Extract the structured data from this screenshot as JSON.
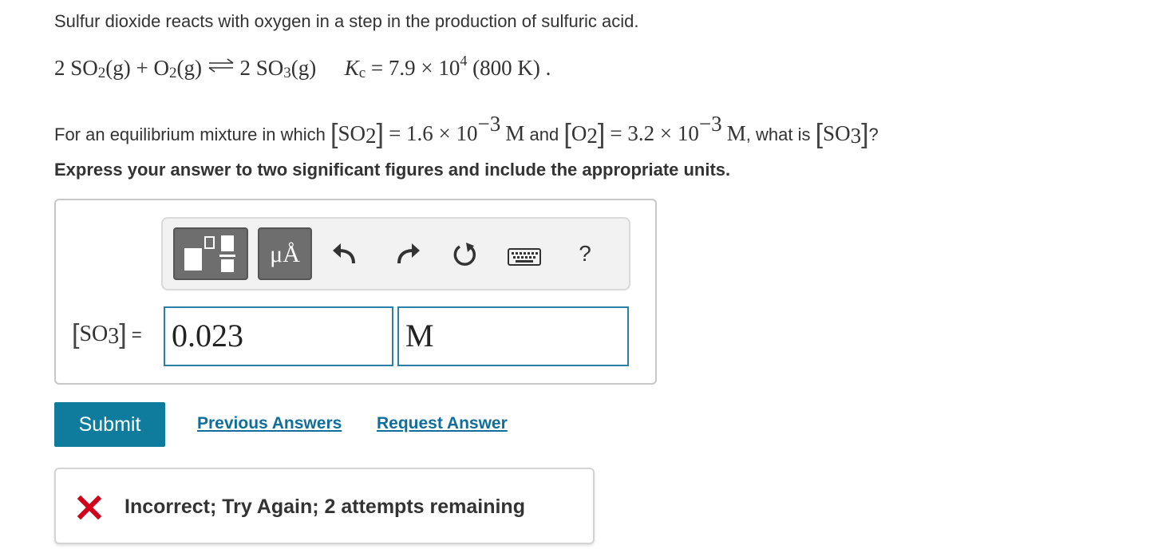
{
  "intro": "Sulfur dioxide reacts with oxygen in a step in the production of sulfuric acid.",
  "equation": {
    "coef1": "2",
    "so2": "SO",
    "so2_sub": "2",
    "phase1": "(g)",
    "plus": "+",
    "o2": "O",
    "o2_sub": "2",
    "phase2": "(g)",
    "coef2": "2",
    "so3": "SO",
    "so3_sub": "3",
    "phase3": "(g)",
    "k": "K",
    "k_sub": "c",
    "k_eq": "= 7.9 × 10",
    "k_exp": "4",
    "temp": "(800 K) ."
  },
  "question": {
    "prefix": "For an equilibrium mixture in which",
    "so2": "SO",
    "so2_sub": "2",
    "so2_val": "= 1.6 × 10",
    "so2_exp": "−3",
    "so2_unit": "M",
    "and": "and",
    "o2": "O",
    "o2_sub": "2",
    "o2_val": "= 3.2 × 10",
    "o2_exp": "−3",
    "o2_unit": "M",
    "what": ", what is",
    "so3": "SO",
    "so3_sub": "3",
    "qmark": "?"
  },
  "instruction": "Express your answer to two significant figures and include the appropriate units.",
  "toolbar": {
    "templates_icon": "templates-icon",
    "units_label": "μÅ",
    "undo_icon": "undo-icon",
    "redo_icon": "redo-icon",
    "reset_icon": "reset-icon",
    "keyboard_icon": "keyboard-icon",
    "help_label": "?"
  },
  "answer": {
    "label_species": "SO",
    "label_sub": "3",
    "label_eq": "=",
    "value": "0.023",
    "unit": "M"
  },
  "actions": {
    "submit_label": "Submit",
    "previous_answers_label": "Previous Answers",
    "request_answer_label": "Request Answer"
  },
  "feedback": {
    "text": "Incorrect; Try Again; 2 attempts remaining",
    "status_color": "#d0021b"
  },
  "colors": {
    "accent": "#0f7c9e",
    "field_border": "#2a7fa9",
    "link": "#0f6e9b"
  }
}
